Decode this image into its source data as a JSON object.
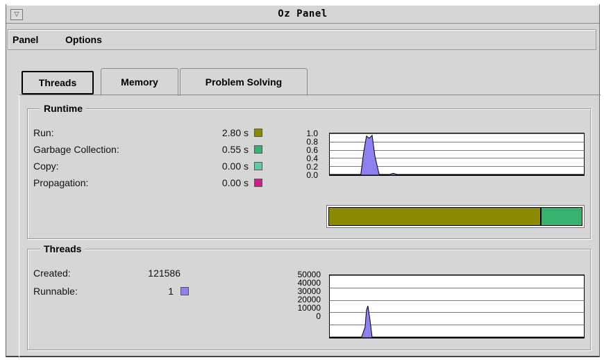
{
  "window": {
    "title": "Oz Panel",
    "menu_button_glyph": "▽"
  },
  "menu": {
    "items": [
      "Panel",
      "Options"
    ]
  },
  "tabs": [
    {
      "label": "Threads",
      "active": true
    },
    {
      "label": "Memory",
      "active": false
    },
    {
      "label": "Problem Solving",
      "active": false
    }
  ],
  "runtime": {
    "title": "Runtime",
    "rows": [
      {
        "label": "Run:",
        "value": "2.80 s",
        "color": "#8b8a00"
      },
      {
        "label": "Garbage Collection:",
        "value": "0.55 s",
        "color": "#37b070"
      },
      {
        "label": "Copy:",
        "value": "0.00 s",
        "color": "#5ecba0"
      },
      {
        "label": "Propagation:",
        "value": "0.00 s",
        "color": "#d01f86"
      }
    ],
    "y_ticks": [
      "1.0",
      "0.8",
      "0.6",
      "0.4",
      "0.2",
      "0.0"
    ],
    "bar_fractions": {
      "run": 0.836,
      "gc": 0.164
    }
  },
  "threads": {
    "title": "Threads",
    "created_label": "Created:",
    "created_value": "121586",
    "runnable_label": "Runnable:",
    "runnable_value": "1",
    "runnable_color": "#8c80f2",
    "y_ticks": [
      "50000",
      "40000",
      "30000",
      "20000",
      "10000",
      "0"
    ]
  },
  "chart_data": [
    {
      "type": "area",
      "ylim": [
        0,
        1.0
      ],
      "y_ticks": [
        1.0,
        0.8,
        0.6,
        0.4,
        0.2,
        0.0
      ],
      "grid": true,
      "series": [
        {
          "color": "#8c80f2",
          "x": [
            0,
            40,
            44,
            48,
            52,
            56,
            60,
            64,
            70,
            85,
            90,
            95,
            120,
            125,
            360
          ],
          "values": [
            0,
            0,
            0,
            0.55,
            0.95,
            0.9,
            0.97,
            0.45,
            0,
            0,
            0.03,
            0,
            0,
            0,
            0
          ]
        }
      ]
    },
    {
      "type": "area",
      "ylim": [
        0,
        50000
      ],
      "y_ticks": [
        50000,
        40000,
        30000,
        20000,
        10000,
        0
      ],
      "grid": true,
      "series": [
        {
          "color": "#8c80f2",
          "x": [
            0,
            40,
            45,
            50,
            52,
            54,
            57,
            60,
            360
          ],
          "values": [
            0,
            0,
            0,
            8000,
            22000,
            25500,
            14000,
            0,
            0
          ]
        }
      ]
    }
  ]
}
